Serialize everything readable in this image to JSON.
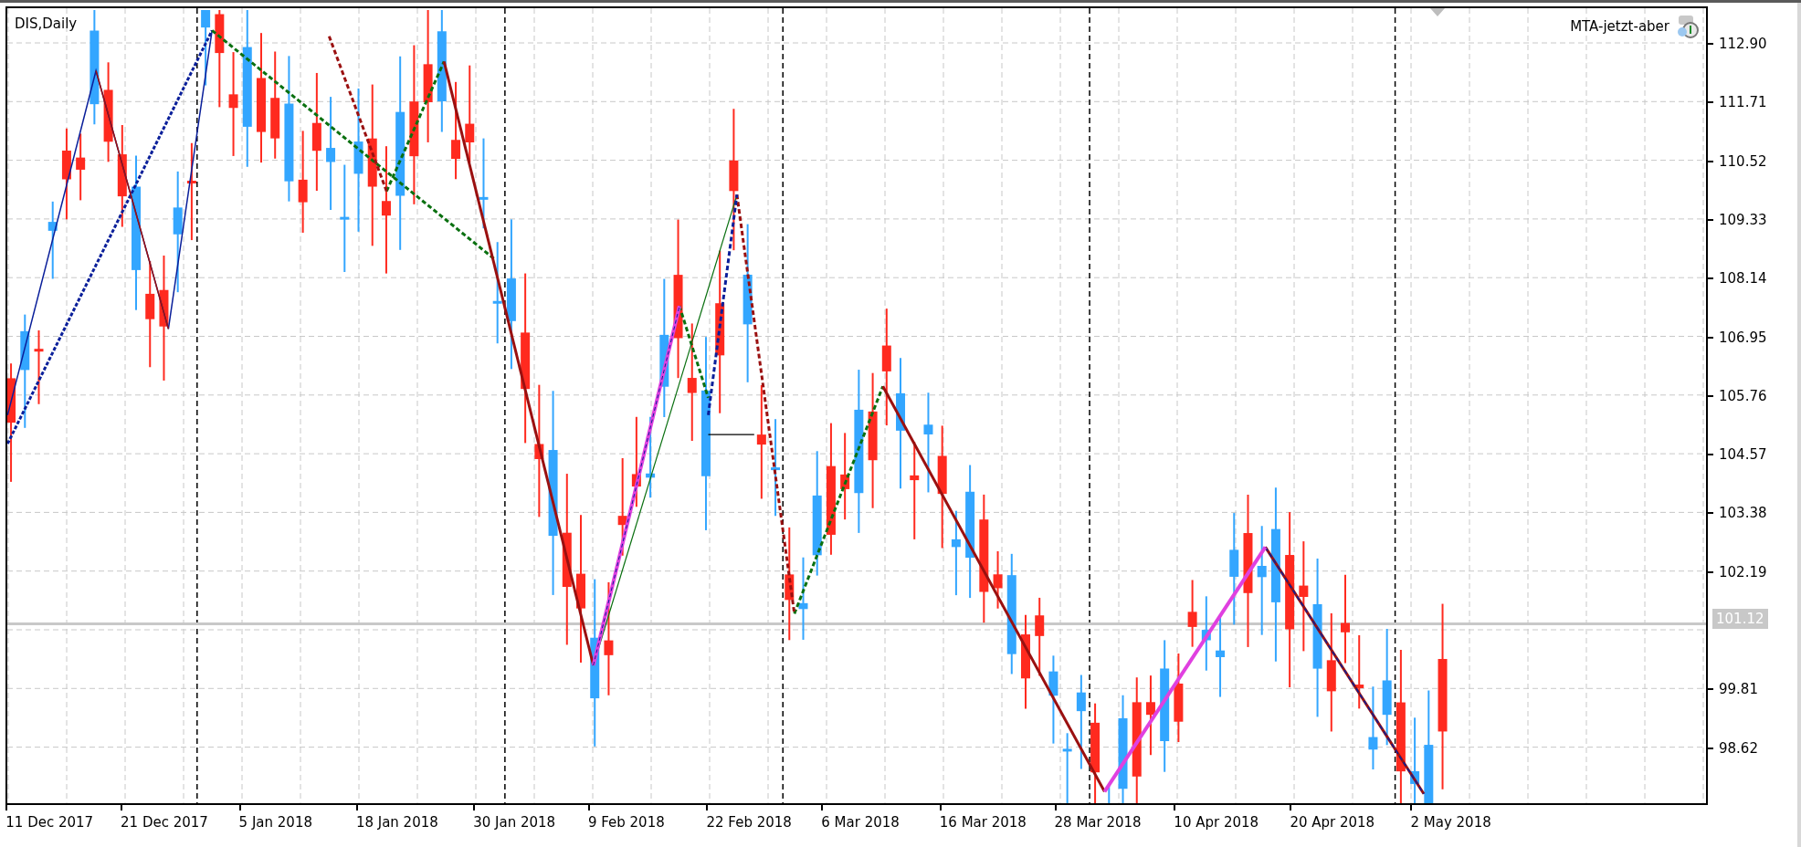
{
  "chart": {
    "symbol_label": "DIS,Daily",
    "expert_label": "MTA-jetzt-aber",
    "price_axis": [
      "112.90",
      "111.71",
      "110.52",
      "109.33",
      "108.14",
      "106.95",
      "105.76",
      "104.57",
      "103.38",
      "102.19",
      "99.81",
      "98.62"
    ],
    "current_price": "101.12",
    "time_axis": [
      "11 Dec 2017",
      "21 Dec 2017",
      "5 Jan 2018",
      "18 Jan 2018",
      "30 Jan 2018",
      "9 Feb 2018",
      "22 Feb 2018",
      "6 Mar 2018",
      "16 Mar 2018",
      "28 Mar 2018",
      "10 Apr 2018",
      "20 Apr 2018",
      "2 May 2018"
    ]
  }
}
